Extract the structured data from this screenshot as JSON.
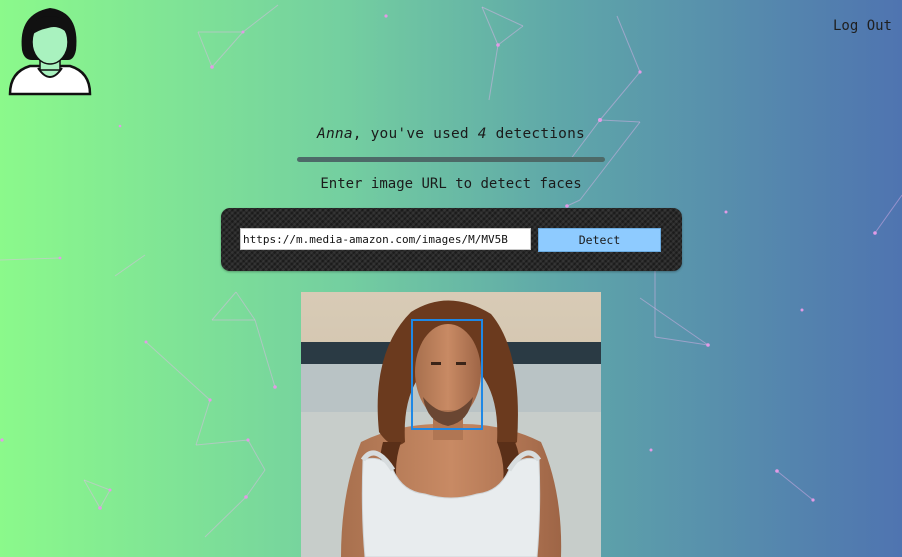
{
  "header": {
    "logout_label": "Log Out"
  },
  "status": {
    "user_name": "Anna",
    "text_middle": ", you've used ",
    "detection_count": "4",
    "text_end": " detections"
  },
  "instruction": "Enter image URL to detect faces",
  "form": {
    "url_value": "https://m.media-amazon.com/images/M/MV5B",
    "detect_label": "Detect"
  },
  "colors": {
    "gradient_left": "#8bf98b",
    "gradient_right": "#4f74b0",
    "face_box": "#1e88e5",
    "detect_button": "#8ecbff",
    "particle_dot": "#e29be6"
  },
  "icons": {
    "avatar": "user-avatar-icon",
    "face_box": "face-bounding-box"
  }
}
